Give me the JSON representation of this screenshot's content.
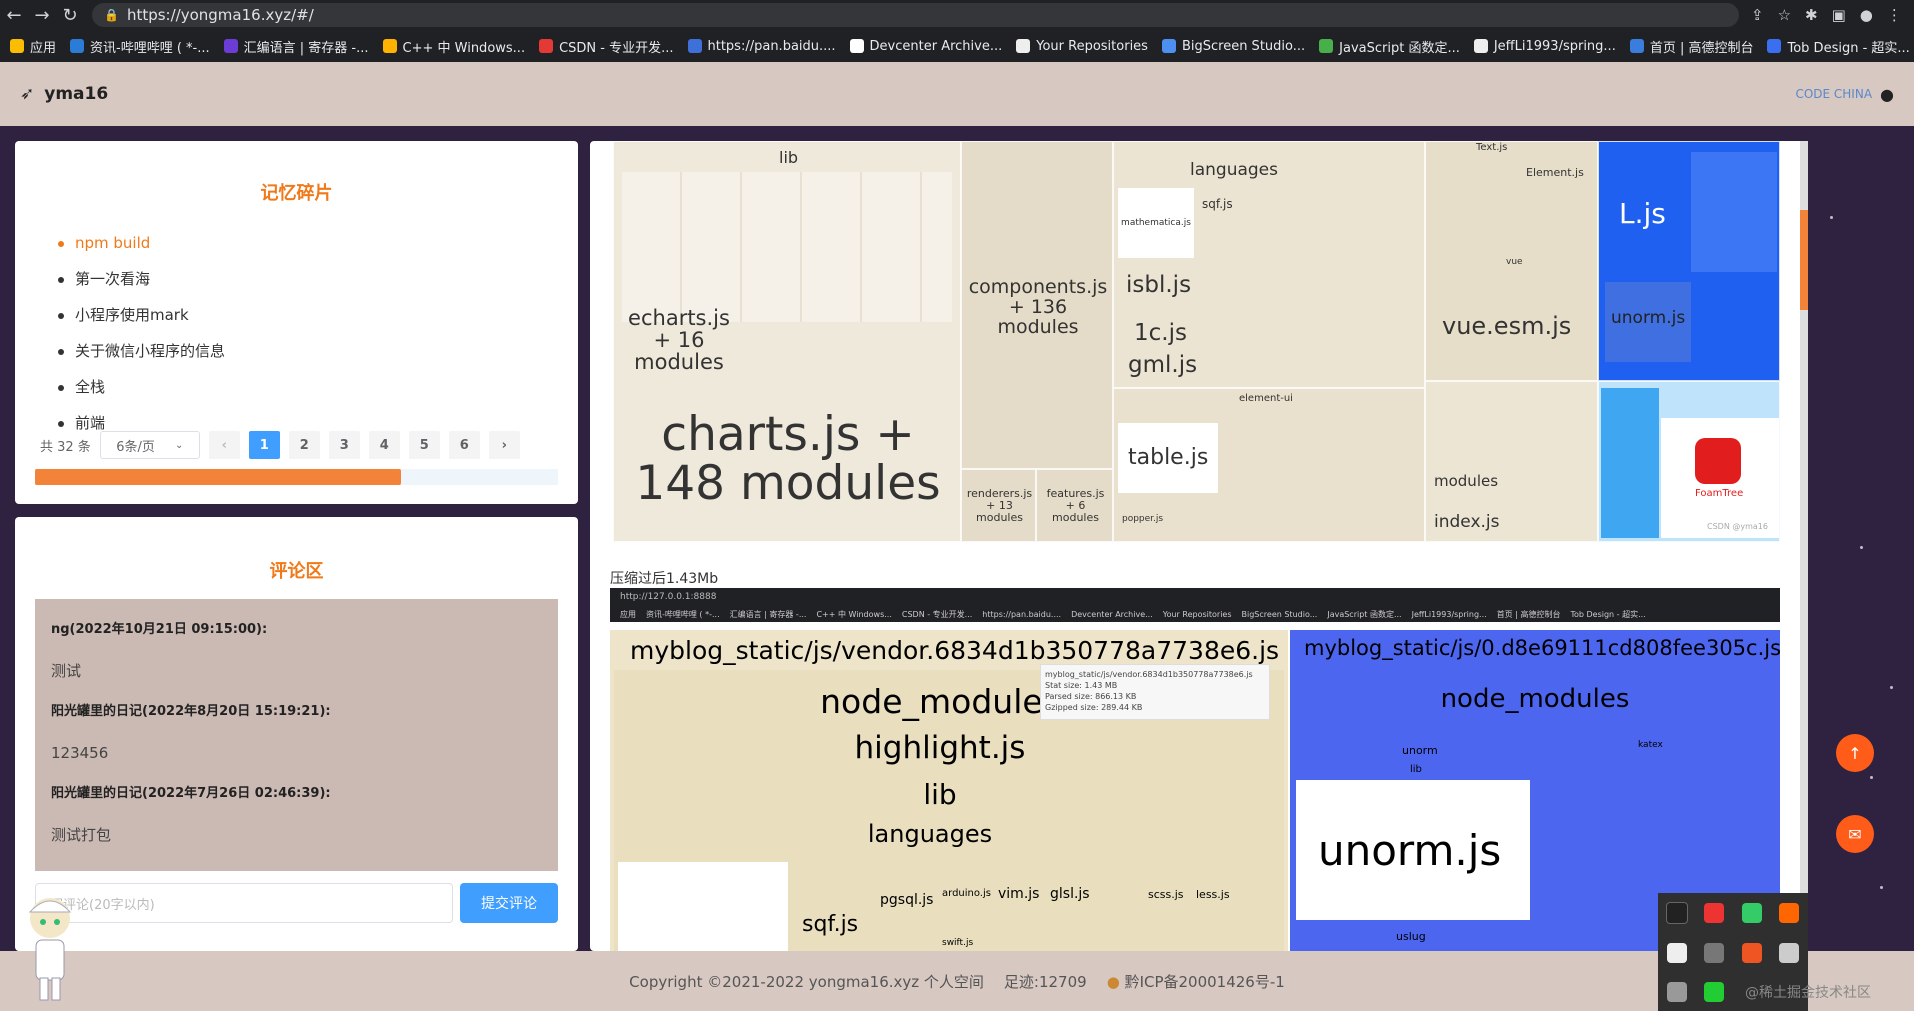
{
  "browser": {
    "url": "https://yongma16.xyz/#/",
    "nav": {
      "back": "←",
      "forward": "→",
      "reload": "↻"
    },
    "bookmarks": [
      {
        "label": "应用",
        "color": "#fbbc04"
      },
      {
        "label": "资讯-哔哩哔哩 ( *-...",
        "color": "#2b7cd6"
      },
      {
        "label": "汇编语言 | 寄存器 -...",
        "color": "#6c3cd6"
      },
      {
        "label": "C++ 中 Windows...",
        "color": "#ffb300"
      },
      {
        "label": "CSDN - 专业开发...",
        "color": "#e53935"
      },
      {
        "label": "https://pan.baidu....",
        "color": "#3f6fd8"
      },
      {
        "label": "Devcenter Archive...",
        "color": "#ffffff"
      },
      {
        "label": "Your Repositories",
        "color": "#eeeeee"
      },
      {
        "label": "BigScreen Studio...",
        "color": "#4e8ff2"
      },
      {
        "label": "JavaScript 函数定...",
        "color": "#47b04b"
      },
      {
        "label": "JeffLi1993/spring...",
        "color": "#eeeeee"
      },
      {
        "label": "首页 | 高德控制台",
        "color": "#3b7ddd"
      },
      {
        "label": "Tob Design - 超实...",
        "color": "#3a6ff2"
      }
    ]
  },
  "header": {
    "brand": "yma16",
    "logo_text": "CODE CHINA"
  },
  "notes": {
    "title": "记忆碎片",
    "items": [
      "npm build",
      "第一次看海",
      "小程序使用mark",
      "关于微信小程序的信息",
      "全栈",
      "前端"
    ],
    "active_index": 0,
    "total": "共 32 条",
    "page_size": "6条/页",
    "pages": [
      "1",
      "2",
      "3",
      "4",
      "5",
      "6"
    ],
    "current_page": "1",
    "prev": "‹",
    "next": "›",
    "scroll_progress": 0.7
  },
  "comments": {
    "title": "评论区",
    "entries": [
      {
        "author": "ng(2022年10月21日 09:15:00):",
        "text": "测试"
      },
      {
        "author": "阳光罐里的日记(2022年8月20日 15:19:21):",
        "text": "123456"
      },
      {
        "author": "阳光罐里的日记(2022年7月26日 02:46:39):",
        "text": "测试打包"
      }
    ],
    "input_placeholder": "写评论(20字以内)",
    "submit": "提交评论"
  },
  "treemap_top": {
    "lib": "lib",
    "charts": "charts.js +",
    "charts2": "148 modules",
    "echarts": "echarts.js",
    "echarts2": "+ 16",
    "echarts3": "modules",
    "components": "components.js",
    "components2": "+ 136",
    "components3": "modules",
    "languages": "languages",
    "isbl": "isbl.js",
    "cjs": "1c.js",
    "gml": "gml.js",
    "sqf": "sqf.js",
    "mathematica": "mathematica.js",
    "vue_esm": "vue.esm.js",
    "vue_dist": "vue",
    "table": "table.js",
    "element_ui": "element-ui",
    "modules": "modules",
    "index": "index.js",
    "ljs": "L.js",
    "unorm": "unorm.js",
    "text": "Text.js",
    "element": "Element.js",
    "renderers": "renderers.js",
    "renderers2": "+ 13",
    "renderers3": "modules",
    "features": "features.js",
    "features2": "+ 6",
    "features3": "modules",
    "popper": "popper.js",
    "foamtree": "FoamTree",
    "csdn": "CSDN @yma16"
  },
  "caption": "压缩过后1.43Mb",
  "embed": {
    "url": "http://127.0.0.1:8888",
    "vendor": "myblog_static/js/vendor.6834d1b350778a7738e6.js",
    "chunk": "myblog_static/js/0.d8e69111cd808fee305c.js",
    "node_modules": "node_modules",
    "highlight": "highlight.js",
    "lib": "lib",
    "languages": "languages",
    "sqf": "sqf.js",
    "pgsql": "pgsql.js",
    "vim": "vim.js",
    "glsl": "glsl.js",
    "scss": "scss.js",
    "less": "less.js",
    "arduino": "arduino.js",
    "swift": "swift.js",
    "node_modules2": "node_modules",
    "unorm_dir": "unorm",
    "lib2": "lib",
    "unorm": "unorm.js",
    "katex": "katex",
    "uslug": "uslug",
    "tooltip_title": "myblog_static/js/vendor.6834d1b350778a7738e6.js",
    "stat": "Stat size: 1.43 MB",
    "parsed": "Parsed size: 866.13 KB",
    "gzipped": "Gzipped size: 289.44 KB"
  },
  "footer": {
    "copyright": "Copyright ©2021-2022 yongma16.xyz 个人空间",
    "visits": "足迹:12709",
    "icp": "黔ICP备20001426号-1"
  },
  "fab": {
    "up": "↑",
    "mail": "✉"
  },
  "watermark": "@稀土掘金技术社区",
  "colors": {
    "accent": "#f07a1a",
    "primary": "#409eff",
    "header_bg": "#d8c8c2",
    "page_bg": "#2e2240"
  }
}
